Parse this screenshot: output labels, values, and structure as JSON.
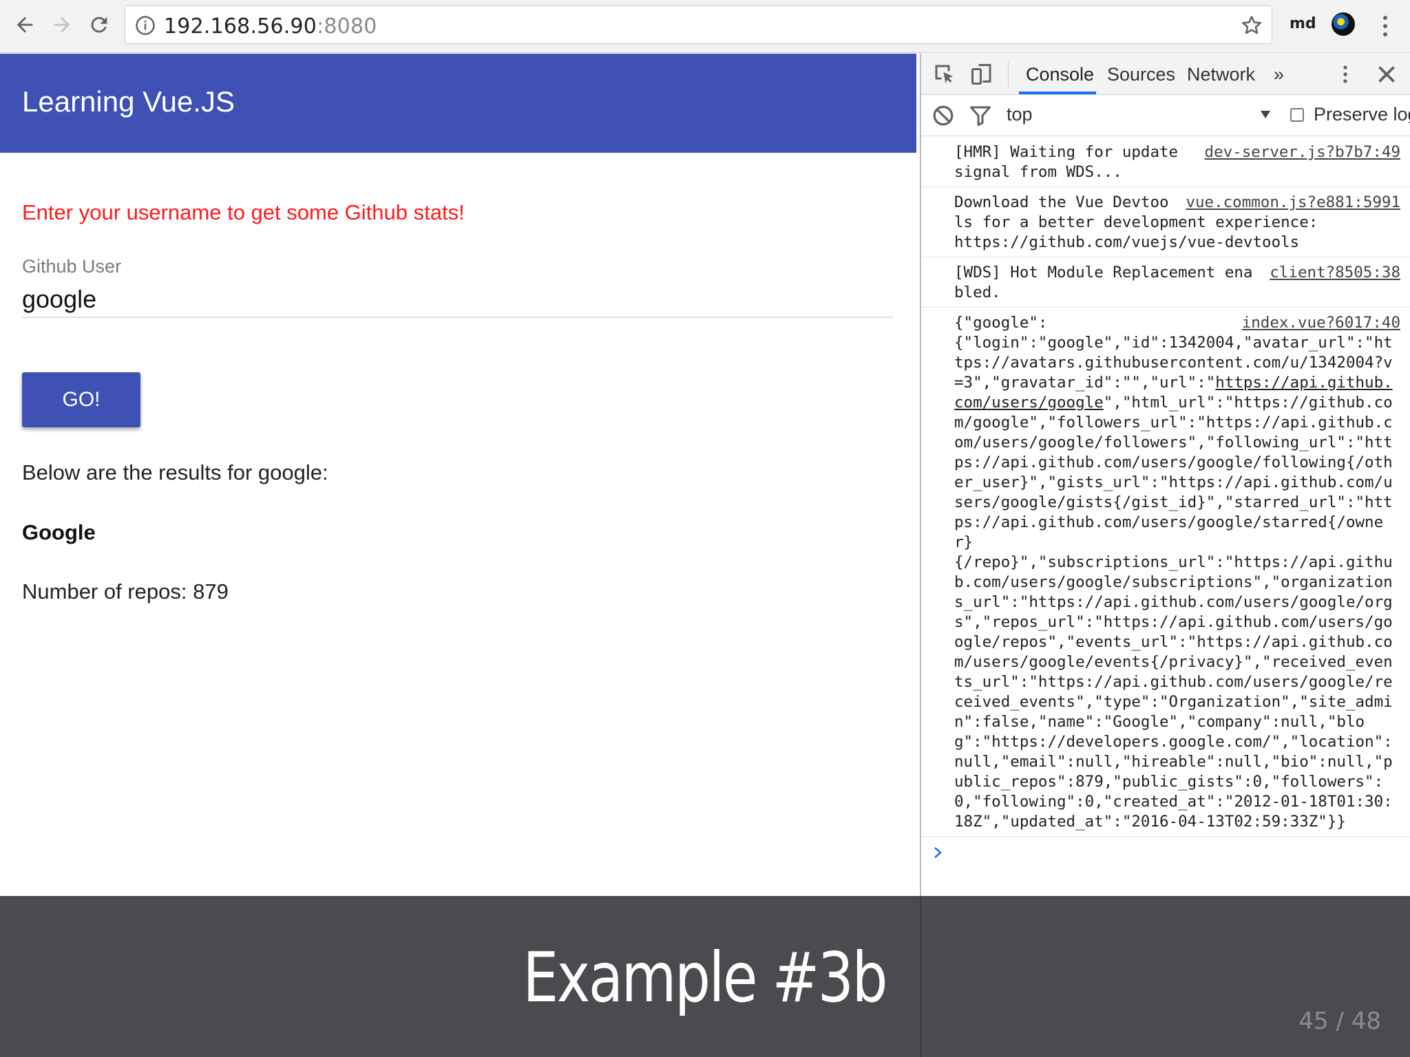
{
  "browser": {
    "url_host": "192.168.56.90",
    "url_port": ":8080",
    "profile": "md"
  },
  "app": {
    "title": "Learning Vue.JS",
    "prompt": "Enter your username to get some Github stats!",
    "field_label": "Github User",
    "field_value": "google",
    "button_label": "GO!",
    "results_text": "Below are the results for google:",
    "org_name": "Google",
    "repos_text": "Number of repos: 879"
  },
  "devtools": {
    "tabs": [
      "Console",
      "Sources",
      "Network",
      "»"
    ],
    "context": "top",
    "preserve_log": "Preserve log",
    "logs": [
      {
        "source": "dev-server.js?b7b7:49",
        "message": "[HMR] Waiting for update signal from WDS..."
      },
      {
        "source": "vue.common.js?e881:5991",
        "message": "Download the Vue Devtools for a better development experience:\nhttps://github.com/vuejs/vue-devtools"
      },
      {
        "source": "client?8505:38",
        "message": "[WDS] Hot Module Replacement enabled."
      },
      {
        "source": "index.vue?6017:40",
        "message_pre": "{\"google\":\n{\"login\":\"google\",\"id\":1342004,\"avatar_url\":\"https://avatars.githubusercontent.com/u/1342004?v=3\",\"gravatar_id\":\"\",\"url\":\"",
        "message_link": "https://api.github.com/users/google",
        "message_post": "\",\"html_url\":\"https://github.com/google\",\"followers_url\":\"https://api.github.com/users/google/followers\",\"following_url\":\"https://api.github.com/users/google/following{/other_user}\",\"gists_url\":\"https://api.github.com/users/google/gists{/gist_id}\",\"starred_url\":\"https://api.github.com/users/google/starred{/owner}\n{/repo}\",\"subscriptions_url\":\"https://api.github.com/users/google/subscriptions\",\"organizations_url\":\"https://api.github.com/users/google/orgs\",\"repos_url\":\"https://api.github.com/users/google/repos\",\"events_url\":\"https://api.github.com/users/google/events{/privacy}\",\"received_events_url\":\"https://api.github.com/users/google/received_events\",\"type\":\"Organization\",\"site_admin\":false,\"name\":\"Google\",\"company\":null,\"blog\":\"https://developers.google.com/\",\"location\":null,\"email\":null,\"hireable\":null,\"bio\":null,\"public_repos\":879,\"public_gists\":0,\"followers\":0,\"following\":0,\"created_at\":\"2012-01-18T01:30:18Z\",\"updated_at\":\"2016-04-13T02:59:33Z\"}}"
      }
    ]
  },
  "slide": {
    "title": "Example #3b",
    "page": "45 / 48"
  },
  "colors": {
    "header": "#3f51b5",
    "prompt_text": "#ff1a1a",
    "footer": "#4b4a4f",
    "tab_accent": "#1a73e8"
  }
}
